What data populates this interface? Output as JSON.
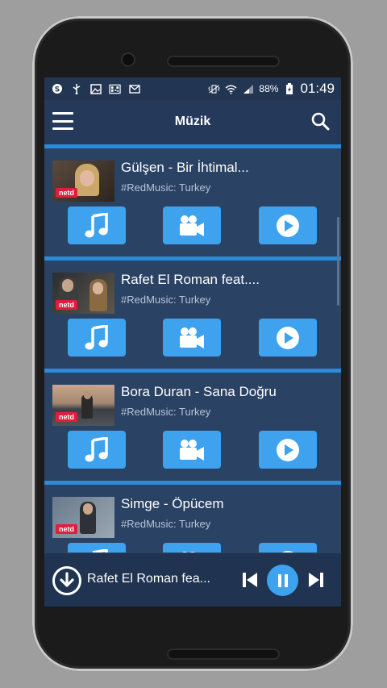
{
  "status": {
    "battery": "88%",
    "time": "01:49"
  },
  "appbar": {
    "title": "Müzik"
  },
  "songs": [
    {
      "title": "Gülşen - Bir İhtimal...",
      "subtitle": "#RedMusic: Turkey",
      "channel_logo": "netd"
    },
    {
      "title": "Rafet El Roman feat....",
      "subtitle": "#RedMusic: Turkey",
      "channel_logo": "netd"
    },
    {
      "title": "Bora Duran - Sana Doğru",
      "subtitle": "#RedMusic: Turkey",
      "channel_logo": "netd"
    },
    {
      "title": "Simge - Öpücem",
      "subtitle": "#RedMusic: Turkey",
      "channel_logo": "netd"
    }
  ],
  "player": {
    "now_playing": "Rafet El Roman fea..."
  },
  "colors": {
    "accent": "#3ea2ee",
    "background": "#263a58",
    "card": "#2a4264",
    "divider": "#2a8bd8"
  }
}
